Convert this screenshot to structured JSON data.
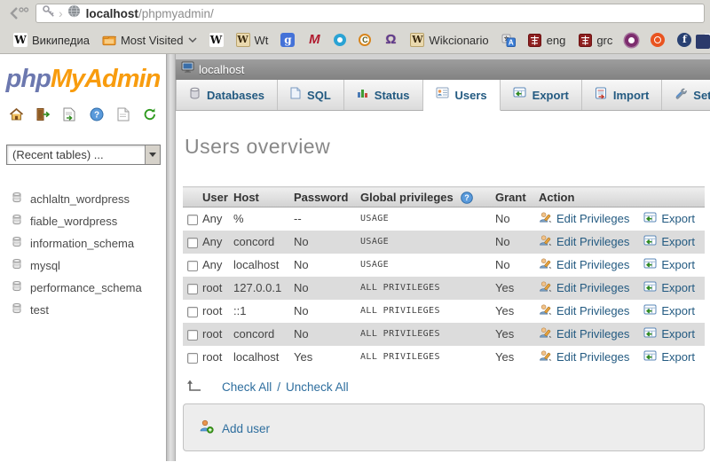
{
  "browser": {
    "url": {
      "host": "localhost",
      "path": "/phpmyadmin/"
    },
    "bookmarks": [
      {
        "label": "Википедиа",
        "icon": "wikipedia-w",
        "icon_text": "W"
      },
      {
        "label": "Most Visited",
        "icon": "folder",
        "icon_text": ""
      },
      {
        "label": "",
        "icon": "wikipedia-w",
        "icon_text": "W"
      },
      {
        "label": "Wt",
        "icon": "wiktionary-book",
        "icon_text": "W"
      },
      {
        "label": "",
        "icon": "google-g",
        "icon_text": "g"
      },
      {
        "label": "",
        "icon": "red-m",
        "icon_text": "M"
      },
      {
        "label": "",
        "icon": "blue-ring",
        "icon_text": ""
      },
      {
        "label": "",
        "icon": "orange-c-ring",
        "icon_text": "C"
      },
      {
        "label": "",
        "icon": "omega",
        "icon_text": "Ω"
      },
      {
        "label": "Wikcionario",
        "icon": "wiktionary-book",
        "icon_text": "W"
      },
      {
        "label": "",
        "icon": "translate",
        "icon_text": "A"
      },
      {
        "label": "eng",
        "icon": "red-seal",
        "icon_text": ""
      },
      {
        "label": "grc",
        "icon": "red-seal",
        "icon_text": ""
      },
      {
        "label": "",
        "icon": "purple-ring",
        "icon_text": ""
      },
      {
        "label": "",
        "icon": "ubuntu",
        "icon_text": ""
      },
      {
        "label": "",
        "icon": "fedora-f",
        "icon_text": "f"
      },
      {
        "label": "",
        "icon": "launchpad",
        "icon_text": "lp"
      },
      {
        "label": "",
        "icon": "partial-favicon",
        "icon_text": ""
      }
    ]
  },
  "sidebar": {
    "logo": {
      "php": "php",
      "myadmin": "MyAdmin"
    },
    "recent_tables_label": "(Recent tables) ...",
    "databases": [
      "achlaltn_wordpress",
      "fiable_wordpress",
      "information_schema",
      "mysql",
      "performance_schema",
      "test"
    ]
  },
  "main": {
    "server_label": "localhost",
    "tabs": [
      {
        "label": "Databases"
      },
      {
        "label": "SQL"
      },
      {
        "label": "Status"
      },
      {
        "label": "Users"
      },
      {
        "label": "Export"
      },
      {
        "label": "Import"
      },
      {
        "label": "Settings"
      }
    ],
    "active_tab": "Users",
    "page_title": "Users overview",
    "users_table": {
      "columns": {
        "user": "User",
        "host": "Host",
        "password": "Password",
        "privileges": "Global privileges",
        "grant": "Grant",
        "action": "Action"
      },
      "edit_label": "Edit Privileges",
      "export_label": "Export",
      "rows": [
        {
          "user": "Any",
          "host": "%",
          "password": "--",
          "privileges": "USAGE",
          "grant": "No"
        },
        {
          "user": "Any",
          "host": "concord",
          "password": "No",
          "privileges": "USAGE",
          "grant": "No"
        },
        {
          "user": "Any",
          "host": "localhost",
          "password": "No",
          "privileges": "USAGE",
          "grant": "No"
        },
        {
          "user": "root",
          "host": "127.0.0.1",
          "password": "No",
          "privileges": "ALL PRIVILEGES",
          "grant": "Yes"
        },
        {
          "user": "root",
          "host": "::1",
          "password": "No",
          "privileges": "ALL PRIVILEGES",
          "grant": "Yes"
        },
        {
          "user": "root",
          "host": "concord",
          "password": "No",
          "privileges": "ALL PRIVILEGES",
          "grant": "Yes"
        },
        {
          "user": "root",
          "host": "localhost",
          "password": "Yes",
          "privileges": "ALL PRIVILEGES",
          "grant": "Yes"
        }
      ]
    },
    "check_all_label": "Check All",
    "uncheck_all_label": "Uncheck All",
    "check_separator": "/",
    "add_user_label": "Add user"
  },
  "colors": {
    "link": "#235a81",
    "red_text": "#e60000",
    "logo_php": "#6c78af",
    "logo_myadmin": "#f89c0e",
    "row_stripe": "#dcdcdc"
  }
}
